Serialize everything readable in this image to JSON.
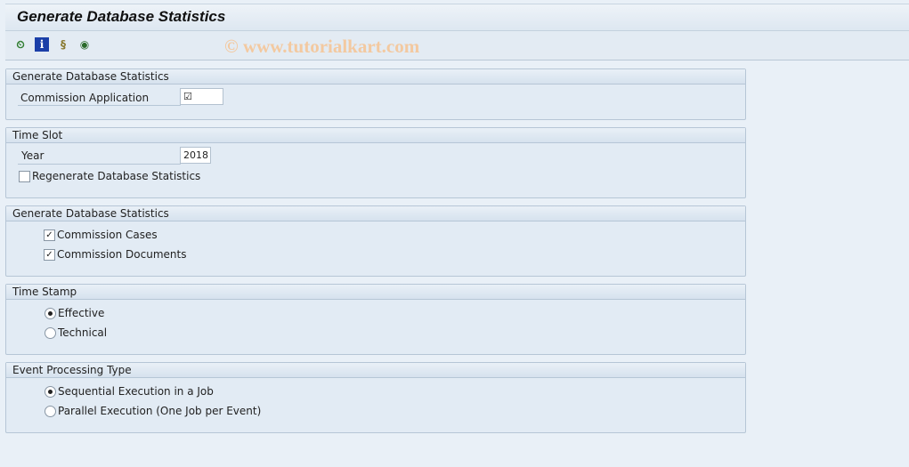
{
  "title": "Generate Database Statistics",
  "toolbar": {
    "icons": [
      "execute-clock-icon",
      "info-icon",
      "scroll-variant-icon",
      "find-icon"
    ]
  },
  "watermark": "© www.tutorialkart.com",
  "panels": [
    {
      "header": "Generate Database Statistics",
      "label": "Commission Application",
      "value": "☑"
    },
    {
      "header": "Time Slot",
      "year_label": "Year",
      "year_value": "2018",
      "regen_label": "Regenerate Database Statistics",
      "regen_checked": false
    },
    {
      "header": "Generate Database Statistics",
      "cases_label": "Commission Cases",
      "cases_checked": true,
      "docs_label": "Commission Documents",
      "docs_checked": true
    },
    {
      "header": "Time Stamp",
      "options": [
        "Effective",
        "Technical"
      ],
      "selected": "Effective"
    },
    {
      "header": "Event Processing Type",
      "options": [
        "Sequential Execution in a Job",
        "Parallel Execution (One Job per Event)"
      ],
      "selected": "Sequential Execution in a Job"
    }
  ]
}
